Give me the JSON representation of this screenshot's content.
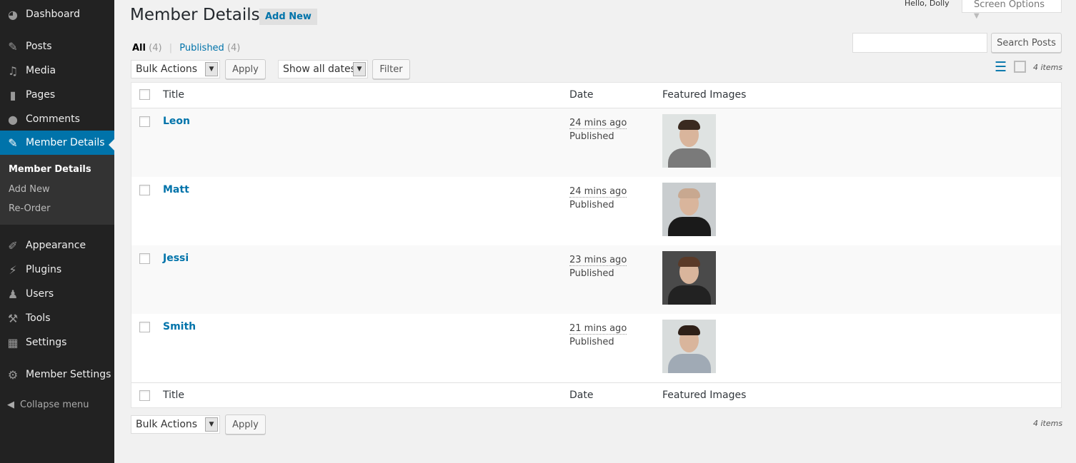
{
  "sidebar": {
    "menu": [
      {
        "label": "Dashboard",
        "icon": "dashboard-icon"
      },
      {
        "label": "Posts",
        "icon": "pin-icon"
      },
      {
        "label": "Media",
        "icon": "media-icon"
      },
      {
        "label": "Pages",
        "icon": "pages-icon"
      },
      {
        "label": "Comments",
        "icon": "comment-icon"
      },
      {
        "label": "Member Details",
        "icon": "pin-icon",
        "active": true
      },
      {
        "label": "Appearance",
        "icon": "brush-icon"
      },
      {
        "label": "Plugins",
        "icon": "plugin-icon"
      },
      {
        "label": "Users",
        "icon": "user-icon"
      },
      {
        "label": "Tools",
        "icon": "wrench-icon"
      },
      {
        "label": "Settings",
        "icon": "settings-icon"
      },
      {
        "label": "Member Settings",
        "icon": "gear-icon"
      }
    ],
    "submenu": [
      "Member Details",
      "Add New",
      "Re-Order"
    ],
    "collapse": "Collapse menu"
  },
  "header": {
    "title": "Member Details",
    "add_new": "Add New",
    "greeting": "Hello, Dolly",
    "screen_options": "Screen Options"
  },
  "filters": {
    "all": "All",
    "all_count": "(4)",
    "published": "Published",
    "published_count": "(4)",
    "bulk": "Bulk Actions",
    "apply": "Apply",
    "dates": "Show all dates",
    "filter": "Filter",
    "search_button": "Search Posts",
    "search_value": "",
    "items": "4 items"
  },
  "table": {
    "columns": [
      "Title",
      "Date",
      "Featured Images"
    ],
    "rows": [
      {
        "title": "Leon",
        "ago": "24 mins ago",
        "status": "Published"
      },
      {
        "title": "Matt",
        "ago": "24 mins ago",
        "status": "Published"
      },
      {
        "title": "Jessi",
        "ago": "23 mins ago",
        "status": "Published"
      },
      {
        "title": "Smith",
        "ago": "21 mins ago",
        "status": "Published"
      }
    ]
  },
  "colors": {
    "accent": "#0073aa",
    "sidebar": "#222222"
  }
}
